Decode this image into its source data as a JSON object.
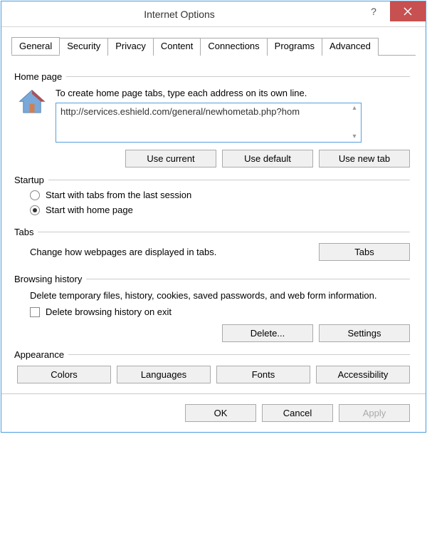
{
  "title": "Internet Options",
  "tabs": [
    "General",
    "Security",
    "Privacy",
    "Content",
    "Connections",
    "Programs",
    "Advanced"
  ],
  "homepage": {
    "label": "Home page",
    "desc": "To create home page tabs, type each address on its own line.",
    "url": "http://services.eshield.com/general/newhometab.php?hom",
    "use_current": "Use current",
    "use_default": "Use default",
    "use_new_tab": "Use new tab"
  },
  "startup": {
    "label": "Startup",
    "opt1": "Start with tabs from the last session",
    "opt2": "Start with home page"
  },
  "tabs_section": {
    "label": "Tabs",
    "text": "Change how webpages are displayed in tabs.",
    "button": "Tabs"
  },
  "history": {
    "label": "Browsing history",
    "text": "Delete temporary files, history, cookies, saved passwords, and web form information.",
    "checkbox": "Delete browsing history on exit",
    "delete": "Delete...",
    "settings": "Settings"
  },
  "appearance": {
    "label": "Appearance",
    "colors": "Colors",
    "languages": "Languages",
    "fonts": "Fonts",
    "accessibility": "Accessibility"
  },
  "footer": {
    "ok": "OK",
    "cancel": "Cancel",
    "apply": "Apply"
  }
}
